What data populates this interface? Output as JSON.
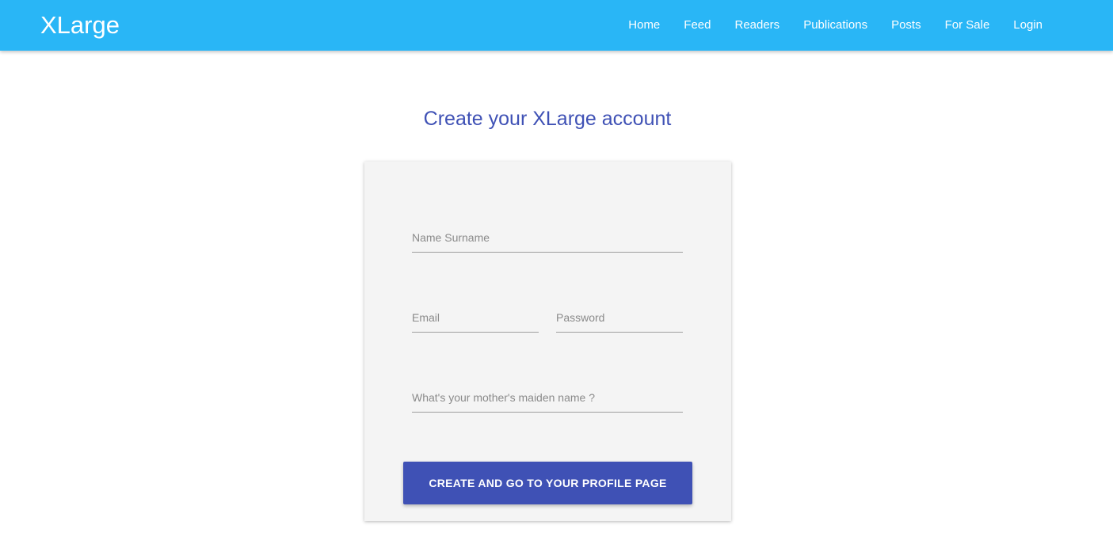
{
  "header": {
    "logo": "XLarge",
    "nav": [
      {
        "label": "Home"
      },
      {
        "label": "Feed"
      },
      {
        "label": "Readers"
      },
      {
        "label": "Publications"
      },
      {
        "label": "Posts"
      },
      {
        "label": "For Sale"
      },
      {
        "label": "Login"
      }
    ]
  },
  "main": {
    "title": "Create your XLarge account"
  },
  "form": {
    "name_placeholder": "Name Surname",
    "email_placeholder": "Email",
    "password_placeholder": "Password",
    "maiden_placeholder": "What's your mother's maiden name ?",
    "submit_label": "CREATE AND GO TO YOUR PROFILE PAGE"
  },
  "colors": {
    "topbar": "#29b6f6",
    "accent": "#3f51b5",
    "card_background": "#f4f4f4"
  }
}
